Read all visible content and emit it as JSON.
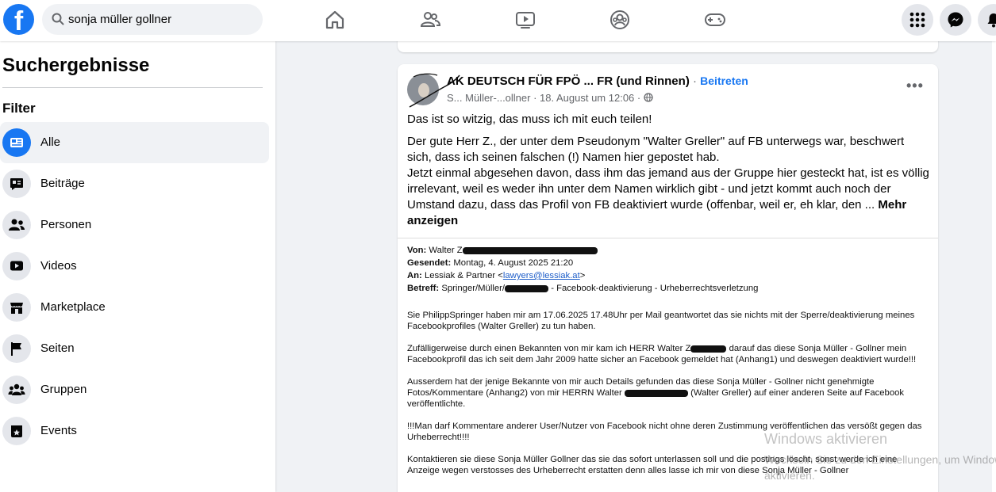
{
  "search": {
    "query": "sonja müller gollner"
  },
  "sidebar": {
    "title": "Suchergebnisse",
    "filter_label": "Filter",
    "items": [
      {
        "label": "Alle",
        "icon": "feed-icon",
        "active": true
      },
      {
        "label": "Beiträge",
        "icon": "post-icon"
      },
      {
        "label": "Personen",
        "icon": "people-icon"
      },
      {
        "label": "Videos",
        "icon": "video-icon"
      },
      {
        "label": "Marketplace",
        "icon": "shop-icon"
      },
      {
        "label": "Seiten",
        "icon": "flag-icon"
      },
      {
        "label": "Gruppen",
        "icon": "groups-icon"
      },
      {
        "label": "Events",
        "icon": "calendar-icon"
      }
    ]
  },
  "post": {
    "group_name": "AK DEUTSCH FÜR FPÖ ... FR (und Rinnen)",
    "separator": "·",
    "join_label": "Beitreten",
    "author_meta": "S... Müller-...ollner · 18. August um 12:06 ·",
    "text_line1": "Das ist so witzig, das muss ich mit euch teilen!",
    "text_para2": "Der gute Herr Z., der unter dem Pseudonym \"Walter Greller\" auf FB unterwegs war, beschwert sich, dass ich seinen falschen (!) Namen hier gepostet hab.",
    "text_para3": "Jetzt einmal abgesehen davon, dass ihm das jemand aus der Gruppe hier gesteckt hat, ist es völlig irrelevant, weil es weder ihn unter dem Namen wirklich gibt - und jetzt kommt auch noch der Umstand dazu, dass das Profil von FB deaktiviert wurde (offenbar, weil er, eh klar, den ...",
    "more_label": "Mehr anzeigen"
  },
  "email": {
    "from_label": "Von:",
    "from_value": "Walter Z",
    "sent_label": "Gesendet:",
    "sent_value": "Montag, 4. August 2025 21:20",
    "to_label": "An:",
    "to_value": "Lessiak & Partner <",
    "to_link": "lawyers@lessiak.at",
    "to_end": ">",
    "subject_label": "Betreff:",
    "subject_value_a": "Springer/Müller/",
    "subject_value_b": " - Facebook-deaktivierung - Urheberrechtsverletzung",
    "p1": "Sie PhilippSpringer haben mir am 17.06.2025  17.48Uhr per Mail geantwortet das sie nichts mit der Sperre/deaktivierung meines Facebookprofiles (Walter Greller) zu tun haben.",
    "p2a": "Zufälligerweise durch einen Bekannten von mir kam ich HERR Walter Z",
    "p2b": " darauf das diese Sonja Müller - Gollner mein Facebookprofil das ich seit dem Jahr 2009 hatte sicher an Facebook gemeldet hat (Anhang1) und deswegen deaktiviert wurde!!!",
    "p3a": "Ausserdem hat der jenige Bekannte von mir auch Details gefunden das diese Sonja Müller - Gollner nicht genehmigte Fotos/Kommentare (Anhang2) von mir HERRN Walter",
    "p3b": " (Walter Greller) auf einer anderen Seite auf Facebook veröffentlichte.",
    "p4": "!!!Man darf Kommentare anderer User/Nutzer von Facebook nicht ohne deren Zustimmung veröffentlichen das versößt gegen das Urheberrecht!!!!",
    "p5": "Kontaktieren sie diese Sonja Müller Gollner das sie das sofort unterlassen soll und die postings löscht, sonst werde ich eine Anzeige wegen verstosses des Urheberrecht erstatten denn alles lasse ich mir von diese Sonja Müller - Gollner"
  },
  "watermark": {
    "line1": "Windows aktivieren",
    "line2": "Wechseln Sie zu den Einstellungen, um Windows zu",
    "line3": "aktivieren."
  },
  "colors": {
    "brand": "#1877f2",
    "background": "#f0f2f5"
  }
}
